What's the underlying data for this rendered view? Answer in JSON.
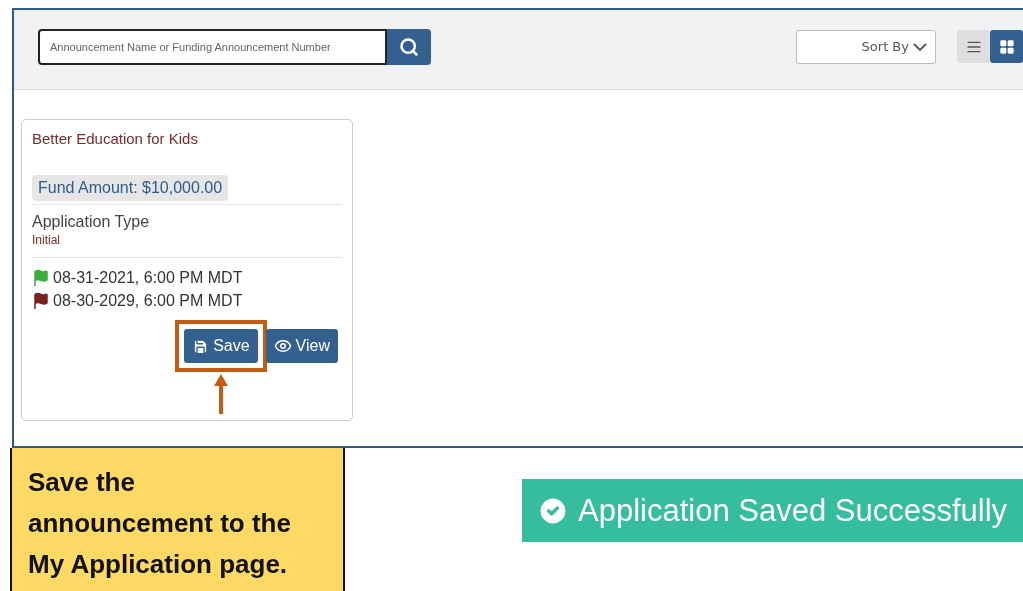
{
  "search": {
    "placeholder": "Announcement Name or Funding Announcement Number"
  },
  "sort": {
    "label": "Sort By"
  },
  "view_toggle": [
    {
      "kind": "list",
      "selected": false
    },
    {
      "kind": "grid",
      "selected": true
    }
  ],
  "card": {
    "title": "Better Education for Kids",
    "fund_amount": "Fund Amount: $10,000.00",
    "field_label": "Application Type",
    "field_value": "Initial",
    "dates": [
      {
        "text": "08-31-2021, 6:00 PM MDT",
        "color": "#3cae3c"
      },
      {
        "text": "08-30-2029, 6:00 PM MDT",
        "color": "#7b2020"
      }
    ],
    "buttons": [
      {
        "kind": "save",
        "label": "Save",
        "highlighted": true
      },
      {
        "kind": "view",
        "label": "View",
        "highlighted": false
      }
    ]
  },
  "callout": {
    "text": "Save the announcement to the My Application page."
  },
  "toast": {
    "text": "Application Saved Successfully"
  }
}
